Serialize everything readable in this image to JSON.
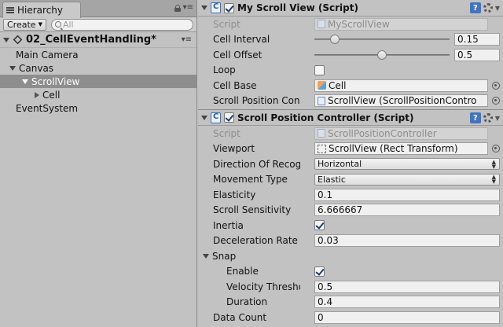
{
  "hierarchy": {
    "tab_label": "Hierarchy",
    "create_label": "Create",
    "search_placeholder": "All",
    "scene_name": "02_CellEventHandling*",
    "items": [
      {
        "label": "Main Camera",
        "indent": 0,
        "arrow": "none",
        "selected": false
      },
      {
        "label": "Canvas",
        "indent": 0,
        "arrow": "down",
        "selected": false
      },
      {
        "label": "ScrollView",
        "indent": 1,
        "arrow": "down",
        "selected": true
      },
      {
        "label": "Cell",
        "indent": 2,
        "arrow": "right",
        "selected": false
      },
      {
        "label": "EventSystem",
        "indent": 0,
        "arrow": "none",
        "selected": false
      }
    ]
  },
  "inspector": {
    "my_scroll_view": {
      "title": "My Scroll View (Script)",
      "enabled": true,
      "script_label": "Script",
      "script_value": "MyScrollView",
      "cell_interval_label": "Cell Interval",
      "cell_interval_value": "0.15",
      "cell_interval_fraction": 0.15,
      "cell_offset_label": "Cell Offset",
      "cell_offset_value": "0.5",
      "cell_offset_fraction": 0.5,
      "loop_label": "Loop",
      "loop_checked": false,
      "cell_base_label": "Cell Base",
      "cell_base_value": "Cell",
      "scroll_position_label": "Scroll Position Contro",
      "scroll_position_value": "ScrollView (ScrollPositionContro"
    },
    "scroll_position_controller": {
      "title": "Scroll Position Controller (Script)",
      "enabled": true,
      "script_label": "Script",
      "script_value": "ScrollPositionController",
      "viewport_label": "Viewport",
      "viewport_value": "ScrollView (Rect Transform)",
      "direction_label": "Direction Of Recogni",
      "direction_value": "Horizontal",
      "movement_label": "Movement Type",
      "movement_value": "Elastic",
      "elasticity_label": "Elasticity",
      "elasticity_value": "0.1",
      "sensitivity_label": "Scroll Sensitivity",
      "sensitivity_value": "6.666667",
      "inertia_label": "Inertia",
      "inertia_checked": true,
      "deceleration_label": "Deceleration Rate",
      "deceleration_value": "0.03",
      "snap_label": "Snap",
      "enable_label": "Enable",
      "enable_checked": true,
      "velocity_label": "Velocity Threshold",
      "velocity_value": "0.5",
      "duration_label": "Duration",
      "duration_value": "0.4",
      "data_count_label": "Data Count",
      "data_count_value": "0"
    }
  }
}
